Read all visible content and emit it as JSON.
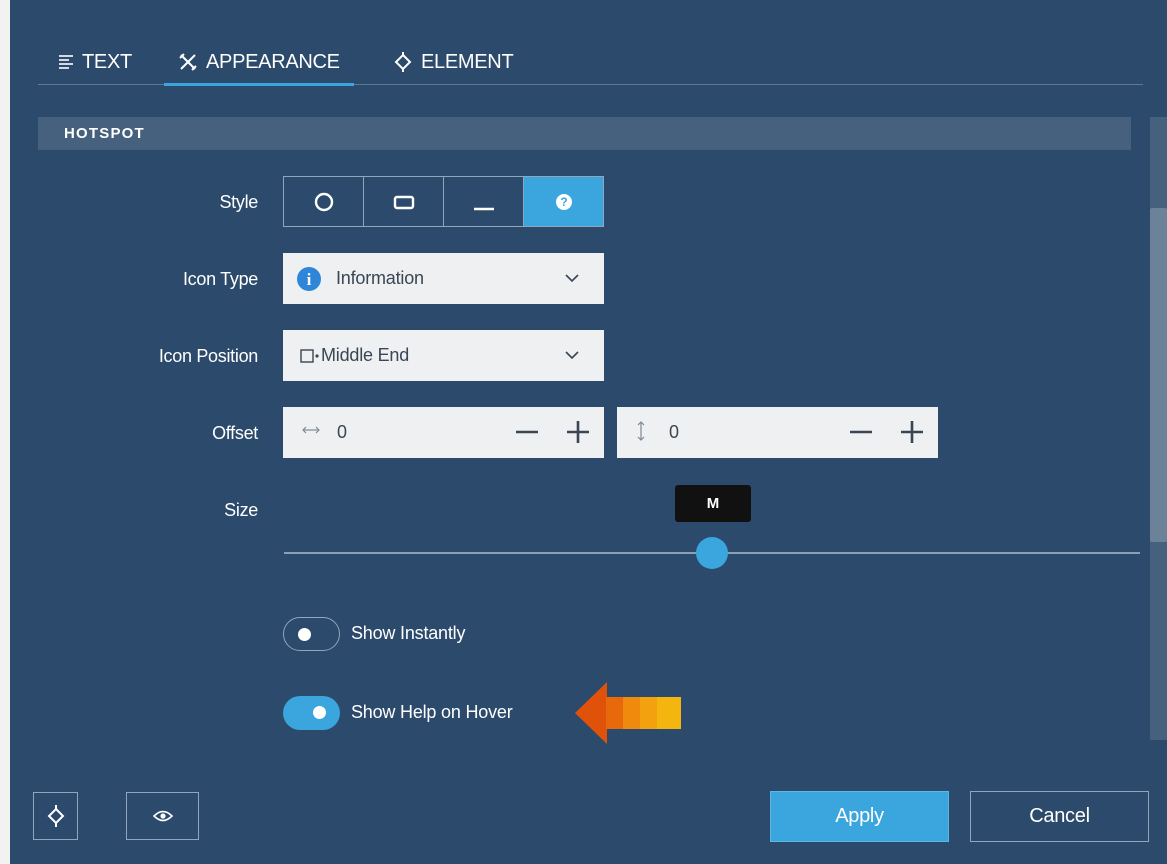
{
  "tabs": [
    {
      "label": "TEXT",
      "icon": "text-align-icon"
    },
    {
      "label": "APPEARANCE",
      "icon": "tools-icon",
      "active": true
    },
    {
      "label": "ELEMENT",
      "icon": "target-icon"
    }
  ],
  "section": {
    "title": "HOTSPOT"
  },
  "style": {
    "label": "Style",
    "options": [
      "circle-icon",
      "rectangle-icon",
      "underline-icon",
      "question-icon"
    ],
    "selected": "question-icon"
  },
  "icon_type": {
    "label": "Icon Type",
    "value": "Information",
    "icon": "info-circle-icon"
  },
  "icon_position": {
    "label": "Icon Position",
    "value": "Middle End",
    "icon": "position-middle-end-icon"
  },
  "offset": {
    "label": "Offset",
    "x": "0",
    "y": "0"
  },
  "size": {
    "label": "Size",
    "value": "M"
  },
  "toggles": {
    "show_instantly": {
      "label": "Show Instantly",
      "on": false
    },
    "show_help_on_hover": {
      "label": "Show Help on Hover",
      "on": true
    }
  },
  "footer": {
    "apply": "Apply",
    "cancel": "Cancel"
  },
  "colors": {
    "background": "#2c4a6b",
    "accent": "#3aa6dd",
    "section": "#46617e",
    "arrow": "#e8620c"
  }
}
